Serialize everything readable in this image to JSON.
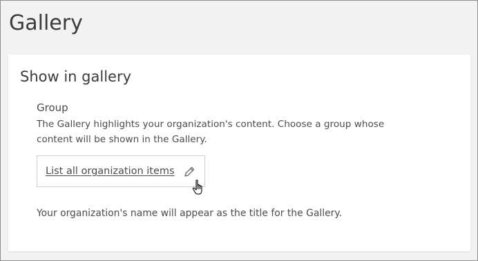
{
  "page": {
    "title": "Gallery"
  },
  "section": {
    "title": "Show in gallery",
    "group_label": "Group",
    "description": "The Gallery highlights your organization's content. Choose a group whose content will be shown in the Gallery.",
    "group_selector": {
      "label": "List all organization items",
      "edit_icon": "pencil-icon"
    },
    "footnote": "Your organization's name will appear as the title for the Gallery."
  },
  "colors": {
    "page_background": "#f2f2f2",
    "card_background": "#ffffff",
    "text": "#4c4c4c",
    "heading": "#3b3b3b",
    "border": "#cfcfcf"
  }
}
